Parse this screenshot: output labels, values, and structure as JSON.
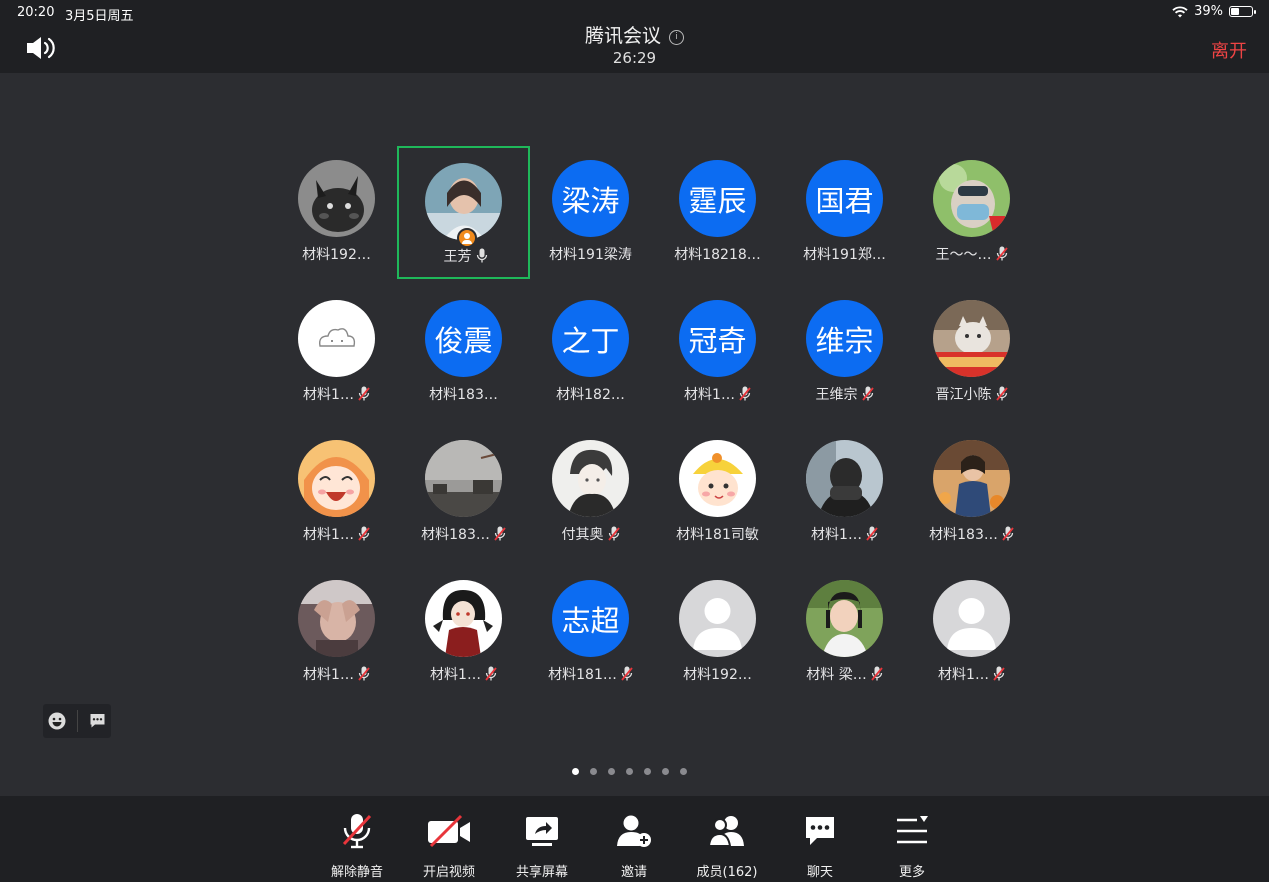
{
  "status_bar": {
    "time": "20:20",
    "date": "3月5日周五",
    "battery": "39%",
    "battery_level": 0.39
  },
  "header": {
    "title": "腾讯会议",
    "info_glyph": "i",
    "duration": "26:29",
    "leave_label": "离开"
  },
  "participants": [
    {
      "name": "材料192…",
      "avatar": "photo-pikachu",
      "mic": "none"
    },
    {
      "name": "王芳",
      "avatar": "photo-woman",
      "mic": "on",
      "active": true,
      "host": true
    },
    {
      "name": "材料191梁涛",
      "avatar_text": "梁涛",
      "mic": "none"
    },
    {
      "name": "材料18218…",
      "avatar_text": "霆辰",
      "mic": "none"
    },
    {
      "name": "材料191郑…",
      "avatar_text": "国君",
      "mic": "none"
    },
    {
      "name": "王～～…",
      "avatar": "photo-mask",
      "mic": "muted"
    },
    {
      "name": "材料1…",
      "avatar": "photo-cloud",
      "mic": "muted"
    },
    {
      "name": "材料183…",
      "avatar_text": "俊震",
      "mic": "none"
    },
    {
      "name": "材料182…",
      "avatar_text": "之丁",
      "mic": "none"
    },
    {
      "name": "材料1…",
      "avatar_text": "冠奇",
      "mic": "muted"
    },
    {
      "name": "王维宗",
      "avatar_text": "维宗",
      "mic": "muted"
    },
    {
      "name": "晋江小陈",
      "avatar": "photo-cat",
      "mic": "muted"
    },
    {
      "name": "材料1…",
      "avatar": "photo-anime-girl",
      "mic": "muted"
    },
    {
      "name": "材料183…",
      "avatar": "photo-sky",
      "mic": "muted"
    },
    {
      "name": "付其奥",
      "avatar": "photo-anime-boy",
      "mic": "muted"
    },
    {
      "name": "材料181司敏",
      "avatar": "photo-duck-girl",
      "mic": "none"
    },
    {
      "name": "材料1…",
      "avatar": "photo-person",
      "mic": "muted"
    },
    {
      "name": "材料183…",
      "avatar": "photo-girl",
      "mic": "muted"
    },
    {
      "name": "材料1…",
      "avatar": "photo-hands",
      "mic": "muted"
    },
    {
      "name": "材料1…",
      "avatar": "photo-ninja",
      "mic": "muted"
    },
    {
      "name": "材料181…",
      "avatar_text": "志超",
      "mic": "muted"
    },
    {
      "name": "材料192…",
      "avatar": "default-person",
      "mic": "none"
    },
    {
      "name": "材料 梁…",
      "avatar": "photo-child",
      "mic": "muted"
    },
    {
      "name": "材料1…",
      "avatar": "default-person",
      "mic": "muted"
    }
  ],
  "pagination": {
    "pages": 7,
    "current": 1
  },
  "float_tools": [
    "emoji-icon",
    "chat-bubble-icon"
  ],
  "toolbar": [
    {
      "id": "unmute",
      "label": "解除静音",
      "icon": "mic-muted-icon"
    },
    {
      "id": "video",
      "label": "开启视频",
      "icon": "camera-off-icon"
    },
    {
      "id": "share",
      "label": "共享屏幕",
      "icon": "share-screen-icon"
    },
    {
      "id": "invite",
      "label": "邀请",
      "icon": "add-person-icon"
    },
    {
      "id": "members",
      "label": "成员(162)",
      "icon": "members-icon"
    },
    {
      "id": "chat",
      "label": "聊天",
      "icon": "chat-icon"
    },
    {
      "id": "more",
      "label": "更多",
      "icon": "more-menu-icon"
    }
  ],
  "colors": {
    "accent_blue": "#0c6cf2",
    "active_border": "#1fb85a",
    "leave_red": "#ef4444",
    "muted_red": "#e8353b",
    "bg": "#2c2d31",
    "bar": "#1f2023"
  }
}
